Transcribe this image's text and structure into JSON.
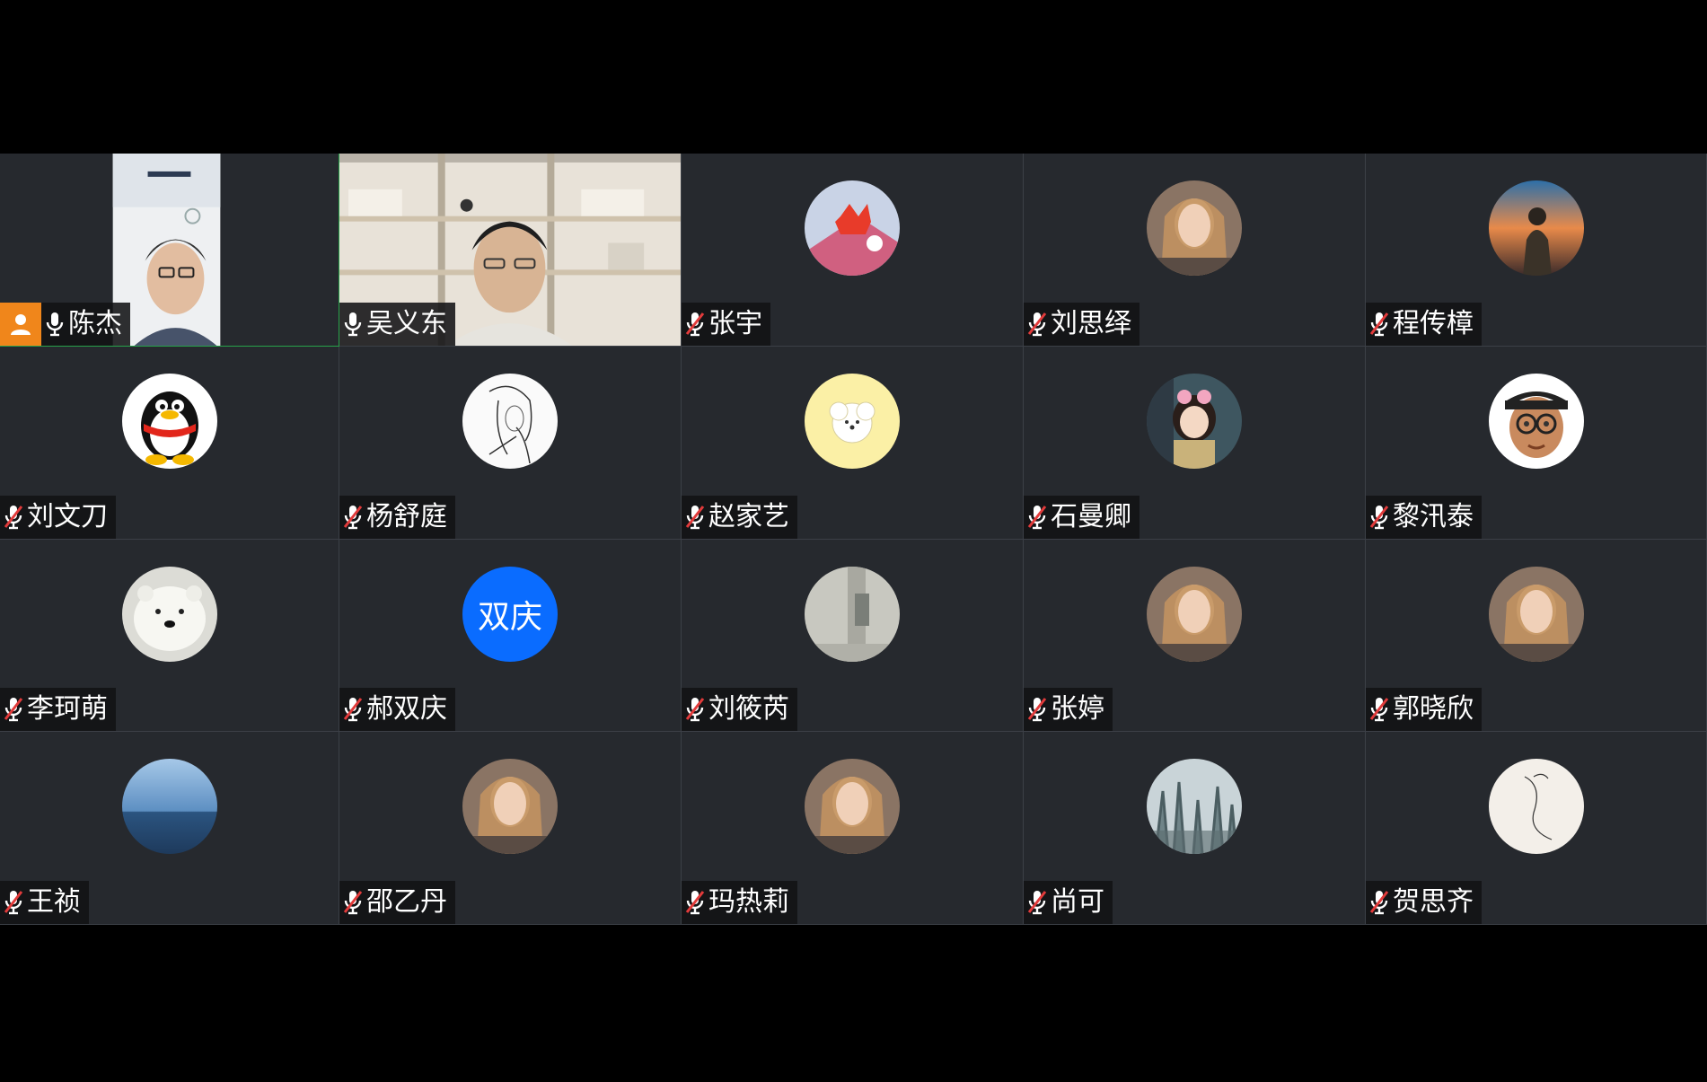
{
  "participants": [
    {
      "name": "陈杰",
      "muted": false,
      "video": true,
      "host": true,
      "active_speaker": true
    },
    {
      "name": "吴义东",
      "muted": false,
      "video": true
    },
    {
      "name": "张宇",
      "muted": true,
      "avatar": "cartoon-fox-avatar"
    },
    {
      "name": "刘思绎",
      "muted": true,
      "avatar": "portrait-photo-avatar"
    },
    {
      "name": "程传樟",
      "muted": true,
      "avatar": "sunset-photo-avatar"
    },
    {
      "name": "刘文刀",
      "muted": true,
      "avatar": "qq-penguin-avatar"
    },
    {
      "name": "杨舒庭",
      "muted": true,
      "avatar": "sketch-drawing-avatar"
    },
    {
      "name": "赵家艺",
      "muted": true,
      "avatar": "cartoon-dog-avatar"
    },
    {
      "name": "石曼卿",
      "muted": true,
      "avatar": "anime-girl-avatar"
    },
    {
      "name": "黎汛泰",
      "muted": true,
      "avatar": "memoji-avatar"
    },
    {
      "name": "李珂萌",
      "muted": true,
      "avatar": "polar-bear-avatar"
    },
    {
      "name": "郝双庆",
      "muted": true,
      "avatar_text": "双庆",
      "avatar_color": "#0a6cff"
    },
    {
      "name": "刘筱芮",
      "muted": true,
      "avatar": "mirror-photo-avatar"
    },
    {
      "name": "张婷",
      "muted": true,
      "avatar": "portrait-photo-avatar"
    },
    {
      "name": "郭晓欣",
      "muted": true,
      "avatar": "portrait-photo-avatar"
    },
    {
      "name": "王祯",
      "muted": true,
      "avatar": "sea-photo-avatar"
    },
    {
      "name": "邵乙丹",
      "muted": true,
      "avatar": "portrait-photo-avatar"
    },
    {
      "name": "玛热莉",
      "muted": true,
      "avatar": "portrait-photo-avatar"
    },
    {
      "name": "尚可",
      "muted": true,
      "avatar": "forest-painting-avatar"
    },
    {
      "name": "贺思齐",
      "muted": true,
      "avatar": "line-art-avatar"
    }
  ],
  "colors": {
    "tile_bg": "#26292e",
    "active_border": "#27a34a",
    "host_badge": "#f0861b",
    "mic_on": "#ffffff",
    "mic_muted_slash": "#e23b3b"
  }
}
